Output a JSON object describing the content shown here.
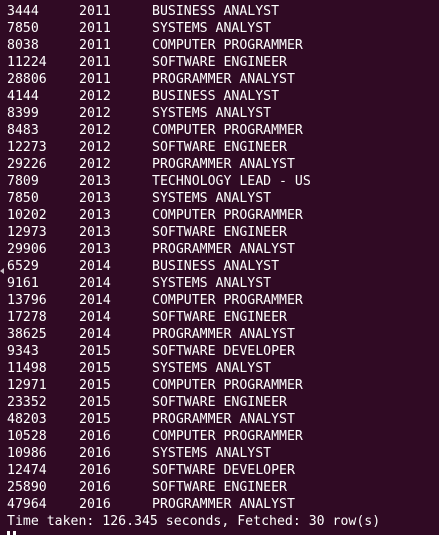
{
  "rows": [
    {
      "count": "3444",
      "year": "2011",
      "title": "BUSINESS ANALYST"
    },
    {
      "count": "7850",
      "year": "2011",
      "title": "SYSTEMS ANALYST"
    },
    {
      "count": "8038",
      "year": "2011",
      "title": "COMPUTER PROGRAMMER"
    },
    {
      "count": "11224",
      "year": "2011",
      "title": "SOFTWARE ENGINEER"
    },
    {
      "count": "28806",
      "year": "2011",
      "title": "PROGRAMMER ANALYST"
    },
    {
      "count": "4144",
      "year": "2012",
      "title": "BUSINESS ANALYST"
    },
    {
      "count": "8399",
      "year": "2012",
      "title": "SYSTEMS ANALYST"
    },
    {
      "count": "8483",
      "year": "2012",
      "title": "COMPUTER PROGRAMMER"
    },
    {
      "count": "12273",
      "year": "2012",
      "title": "SOFTWARE ENGINEER"
    },
    {
      "count": "29226",
      "year": "2012",
      "title": "PROGRAMMER ANALYST"
    },
    {
      "count": "7809",
      "year": "2013",
      "title": "TECHNOLOGY LEAD - US"
    },
    {
      "count": "7850",
      "year": "2013",
      "title": "SYSTEMS ANALYST"
    },
    {
      "count": "10202",
      "year": "2013",
      "title": "COMPUTER PROGRAMMER"
    },
    {
      "count": "12973",
      "year": "2013",
      "title": "SOFTWARE ENGINEER"
    },
    {
      "count": "29906",
      "year": "2013",
      "title": "PROGRAMMER ANALYST"
    },
    {
      "count": "6529",
      "year": "2014",
      "title": "BUSINESS ANALYST"
    },
    {
      "count": "9161",
      "year": "2014",
      "title": "SYSTEMS ANALYST"
    },
    {
      "count": "13796",
      "year": "2014",
      "title": "COMPUTER PROGRAMMER"
    },
    {
      "count": "17278",
      "year": "2014",
      "title": "SOFTWARE ENGINEER"
    },
    {
      "count": "38625",
      "year": "2014",
      "title": "PROGRAMMER ANALYST"
    },
    {
      "count": "9343",
      "year": "2015",
      "title": "SOFTWARE DEVELOPER"
    },
    {
      "count": "11498",
      "year": "2015",
      "title": "SYSTEMS ANALYST"
    },
    {
      "count": "12971",
      "year": "2015",
      "title": "COMPUTER PROGRAMMER"
    },
    {
      "count": "23352",
      "year": "2015",
      "title": "SOFTWARE ENGINEER"
    },
    {
      "count": "48203",
      "year": "2015",
      "title": "PROGRAMMER ANALYST"
    },
    {
      "count": "10528",
      "year": "2016",
      "title": "COMPUTER PROGRAMMER"
    },
    {
      "count": "10986",
      "year": "2016",
      "title": "SYSTEMS ANALYST"
    },
    {
      "count": "12474",
      "year": "2016",
      "title": "SOFTWARE DEVELOPER"
    },
    {
      "count": "25890",
      "year": "2016",
      "title": "SOFTWARE ENGINEER"
    },
    {
      "count": "47964",
      "year": "2016",
      "title": "PROGRAMMER ANALYST"
    }
  ],
  "footer": "Time taken: 126.345 seconds, Fetched: 30 row(s)",
  "colors": {
    "background": "#300a24",
    "text": "#ffffff"
  }
}
